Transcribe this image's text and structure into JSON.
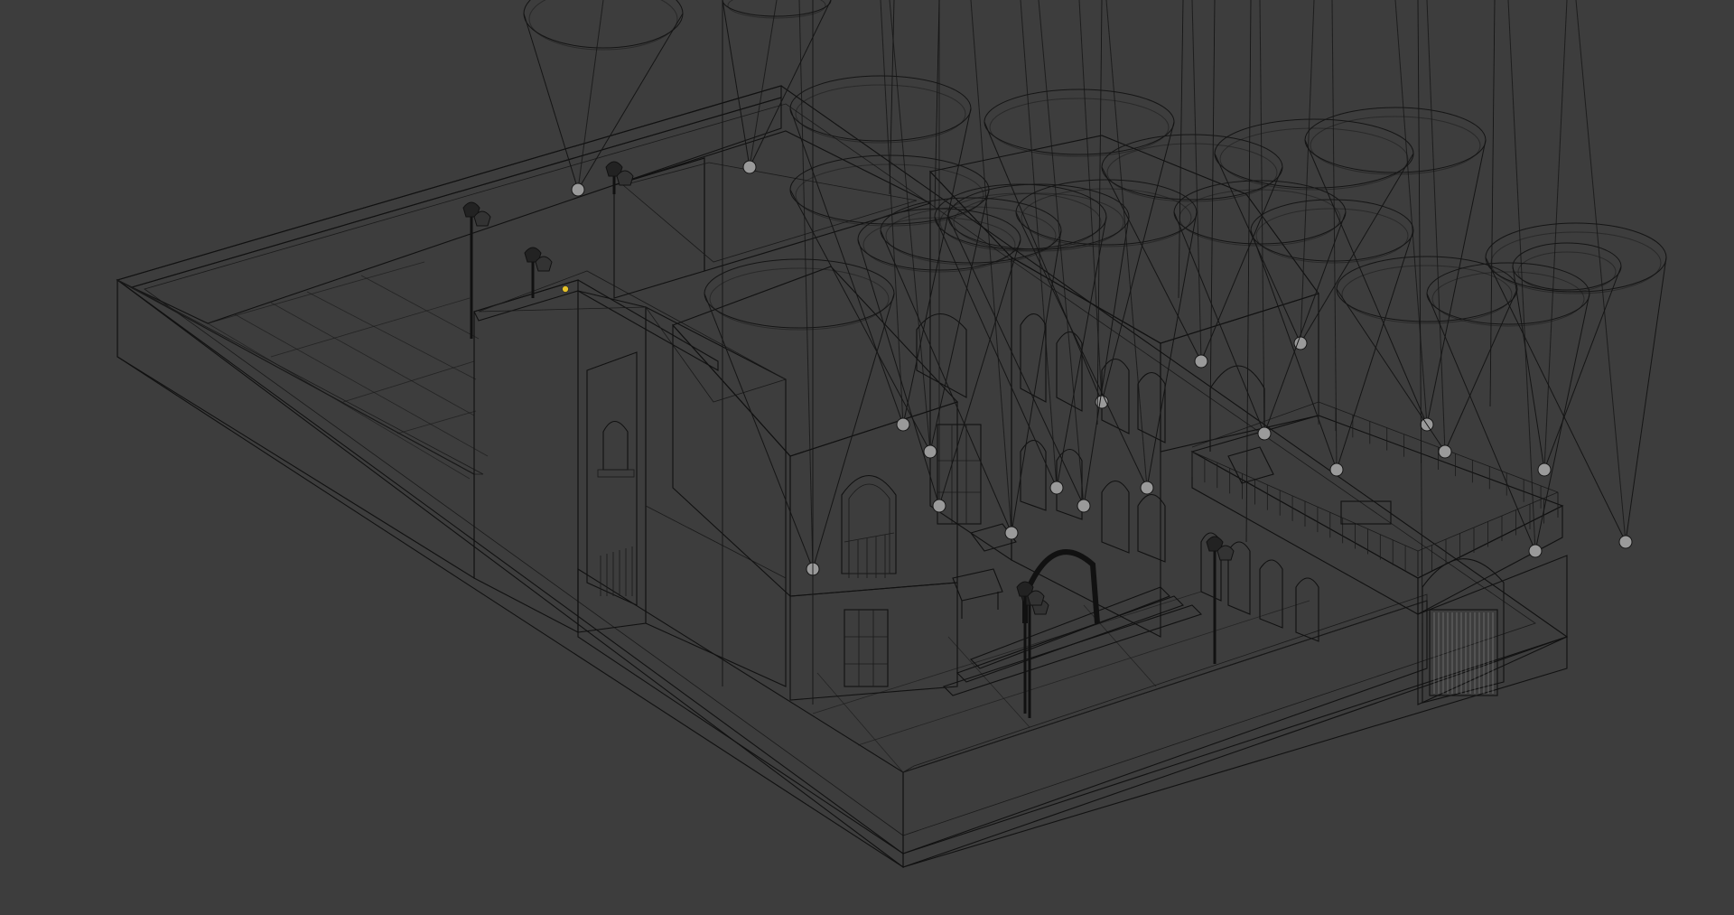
{
  "app": {
    "name": "3D viewport"
  },
  "viewport": {
    "background": "#3d3d3d",
    "shading": "solid-with-wireframe",
    "model_fill": "#a9a9a9",
    "wire_color": "#111111",
    "selected_light_color": "#e6c22a"
  },
  "scene": {
    "objects": [
      "building-model",
      "spot-lights",
      "street-lamps",
      "arch-trellis",
      "courtyard-furniture",
      "rooftop-railing",
      "gate"
    ]
  }
}
